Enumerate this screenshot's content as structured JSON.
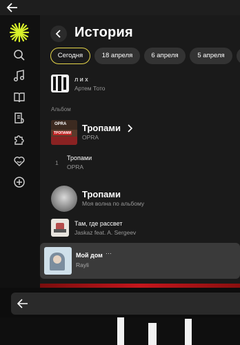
{
  "header": {
    "title": "История"
  },
  "chips": [
    {
      "label": "Сегодня",
      "active": true
    },
    {
      "label": "18 апреля",
      "active": false
    },
    {
      "label": "6 апреля",
      "active": false
    },
    {
      "label": "5 апреля",
      "active": false
    }
  ],
  "history": {
    "first_item": {
      "title": "л и х",
      "artist": "Артем Тото"
    },
    "section_label": "Альбом",
    "album": {
      "title": "Тропами",
      "artist": "OPRA",
      "cover_text": "OPRA",
      "cover_subtext": "ТРОПАМИ"
    },
    "album_track": {
      "number": "1",
      "title": "Тропами",
      "artist": "OPRA"
    },
    "wave": {
      "title": "Тропами",
      "subtitle": "Моя волна по альбому"
    },
    "track_sunrise": {
      "title": "Там, где рассвет",
      "artist": "Jaskaz feat. A. Sergeev"
    }
  },
  "now_playing": {
    "title": "Мой дом",
    "artist": "Rayli",
    "more_label": "···"
  },
  "colors": {
    "accent": "#e6d64a",
    "logo": "#d8f02a",
    "strip": "#c4161c"
  }
}
